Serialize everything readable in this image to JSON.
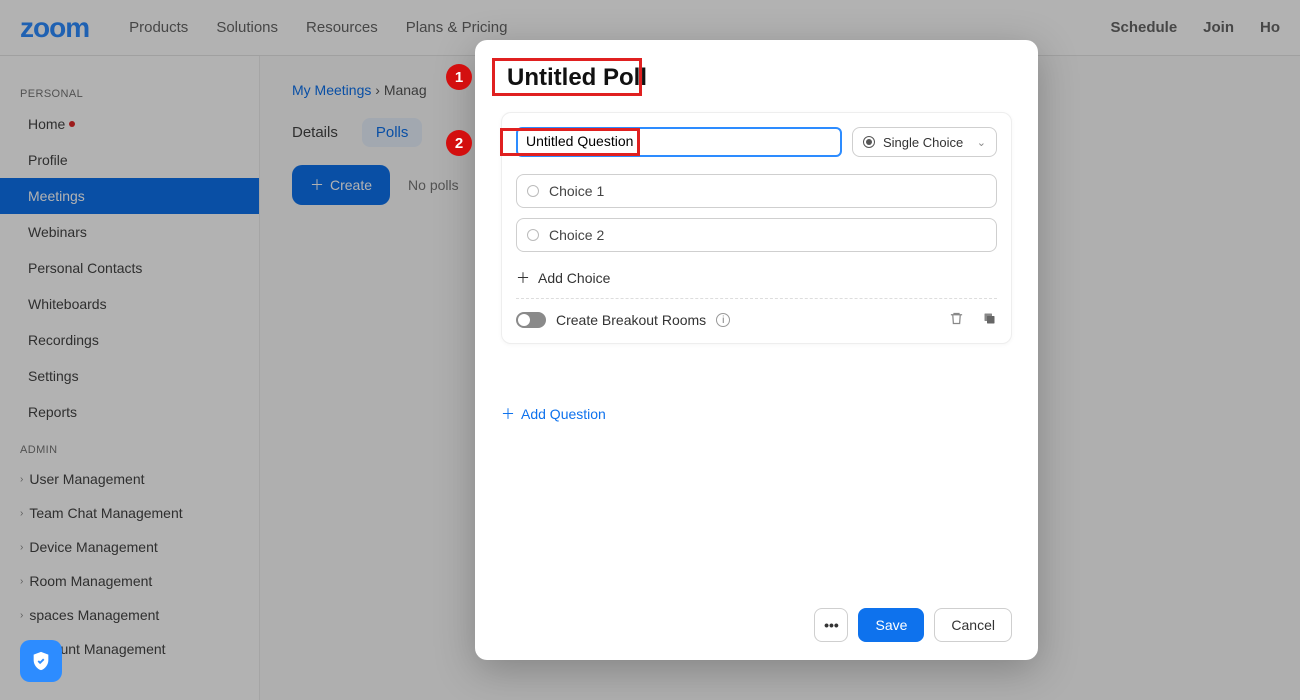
{
  "brand": "zoom",
  "topnav": [
    "Products",
    "Solutions",
    "Resources",
    "Plans & Pricing"
  ],
  "topnav_right": [
    "Schedule",
    "Join",
    "Ho"
  ],
  "sidebar": {
    "section_personal": "PERSONAL",
    "items": [
      "Home",
      "Profile",
      "Meetings",
      "Webinars",
      "Personal Contacts",
      "Whiteboards",
      "Recordings",
      "Settings",
      "Reports"
    ],
    "section_admin": "ADMIN",
    "admin_items": [
      "User Management",
      "Team Chat Management",
      "Device Management",
      "Room Management",
      "spaces Management",
      "Account Management"
    ]
  },
  "breadcrumb": {
    "root": "My Meetings",
    "current": "Manag"
  },
  "tabs": {
    "details": "Details",
    "polls": "Polls"
  },
  "create_btn": "Create",
  "no_polls_text": "No polls",
  "modal": {
    "title": "Untitled Poll",
    "question_value": "Untitled Question",
    "type_label": "Single Choice",
    "choice1": "Choice 1",
    "choice2": "Choice 2",
    "add_choice": "Add Choice",
    "breakout": "Create Breakout Rooms",
    "add_question": "Add Question",
    "more": "•••",
    "save": "Save",
    "cancel": "Cancel"
  },
  "annotations": {
    "1": "1",
    "2": "2"
  }
}
